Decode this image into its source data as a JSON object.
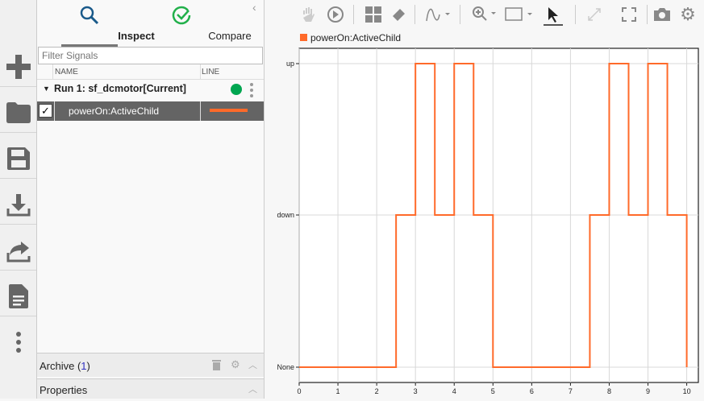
{
  "tabs": {
    "inspect": "Inspect",
    "compare": "Compare"
  },
  "filter": {
    "placeholder": "Filter Signals"
  },
  "columns": {
    "name": "NAME",
    "line": "LINE"
  },
  "run": {
    "label": "Run 1: sf_dcmotor[Current]",
    "status_color": "#00a650"
  },
  "signal": {
    "name": "powerOn:ActiveChild",
    "checked": true,
    "color": "#ff6a2a"
  },
  "archive": {
    "label": "Archive (",
    "count": "1",
    "close": ")"
  },
  "properties": {
    "label": "Properties"
  },
  "chart_data": {
    "type": "line",
    "step": true,
    "legend": [
      "powerOn:ActiveChild"
    ],
    "legend_placement": "top-left",
    "xlim": [
      0,
      10.3
    ],
    "xticks": [
      "0",
      "1",
      "2",
      "3",
      "4",
      "5",
      "6",
      "7",
      "8",
      "9",
      "10"
    ],
    "yticks": [
      "None",
      "down",
      "up"
    ],
    "grid": true,
    "series": [
      {
        "name": "powerOn:ActiveChild",
        "color": "#ff6a2a",
        "x": [
          0,
          2.5,
          3,
          3.5,
          4,
          4.5,
          5,
          7.5,
          8,
          8.5,
          9,
          9.5,
          10
        ],
        "y": [
          "None",
          "down",
          "up",
          "down",
          "up",
          "down",
          "None",
          "down",
          "up",
          "down",
          "up",
          "down",
          "None"
        ]
      }
    ]
  }
}
